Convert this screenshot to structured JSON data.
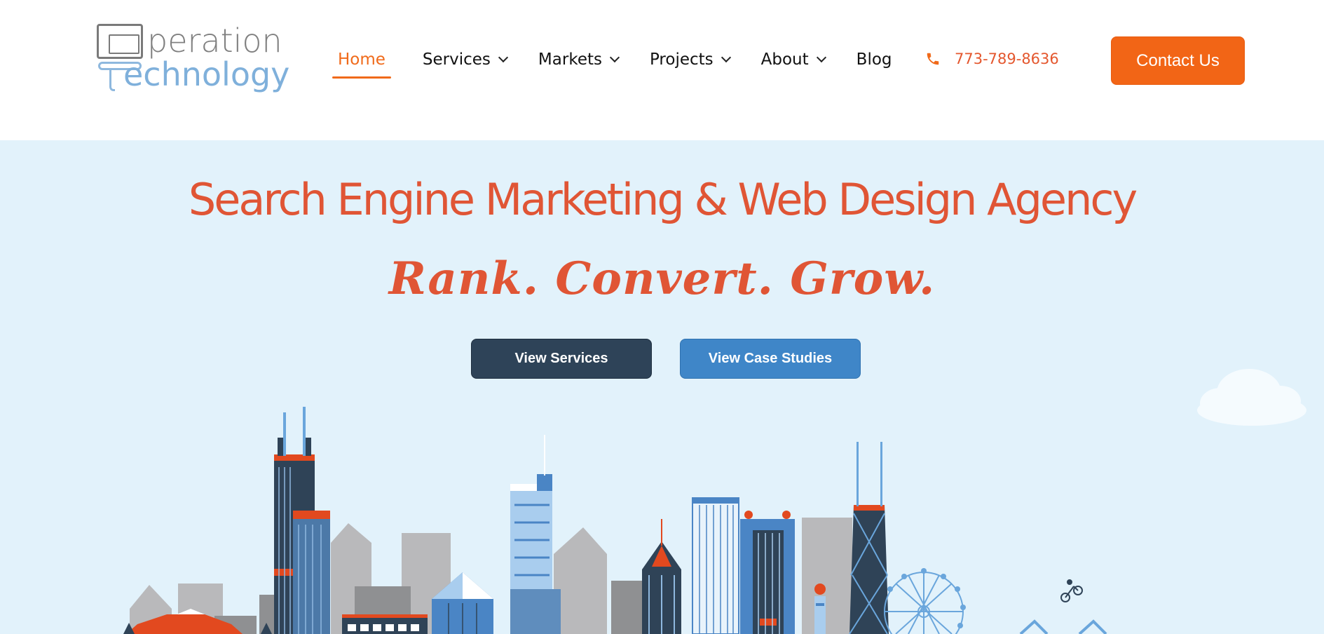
{
  "header": {
    "logo": {
      "line1": "peration",
      "line2": "echnology",
      "alt": "Operation Technology"
    },
    "nav": [
      {
        "label": "Home",
        "active": true,
        "dropdown": false
      },
      {
        "label": "Services",
        "active": false,
        "dropdown": true
      },
      {
        "label": "Markets",
        "active": false,
        "dropdown": true
      },
      {
        "label": "Projects",
        "active": false,
        "dropdown": true
      },
      {
        "label": "About",
        "active": false,
        "dropdown": true
      },
      {
        "label": "Blog",
        "active": false,
        "dropdown": false
      }
    ],
    "phone": {
      "icon": "phone-icon",
      "number": "773-789-8636"
    },
    "contact_label": "Contact Us"
  },
  "hero": {
    "title": "Search Engine Marketing & Web Design Agency",
    "tagline": "Rank. Convert. Grow.",
    "buttons": {
      "services": "View Services",
      "cases": "View Case Studies"
    },
    "illustration": "city-skyline-illustration"
  },
  "colors": {
    "accent_orange": "#f26516",
    "title_red": "#e05535",
    "hero_bg": "#e2f2fb",
    "dark_button": "#2e4358",
    "blue_button": "#3f86c8",
    "logo_gray": "#808080",
    "logo_blue": "#7fb0db"
  }
}
